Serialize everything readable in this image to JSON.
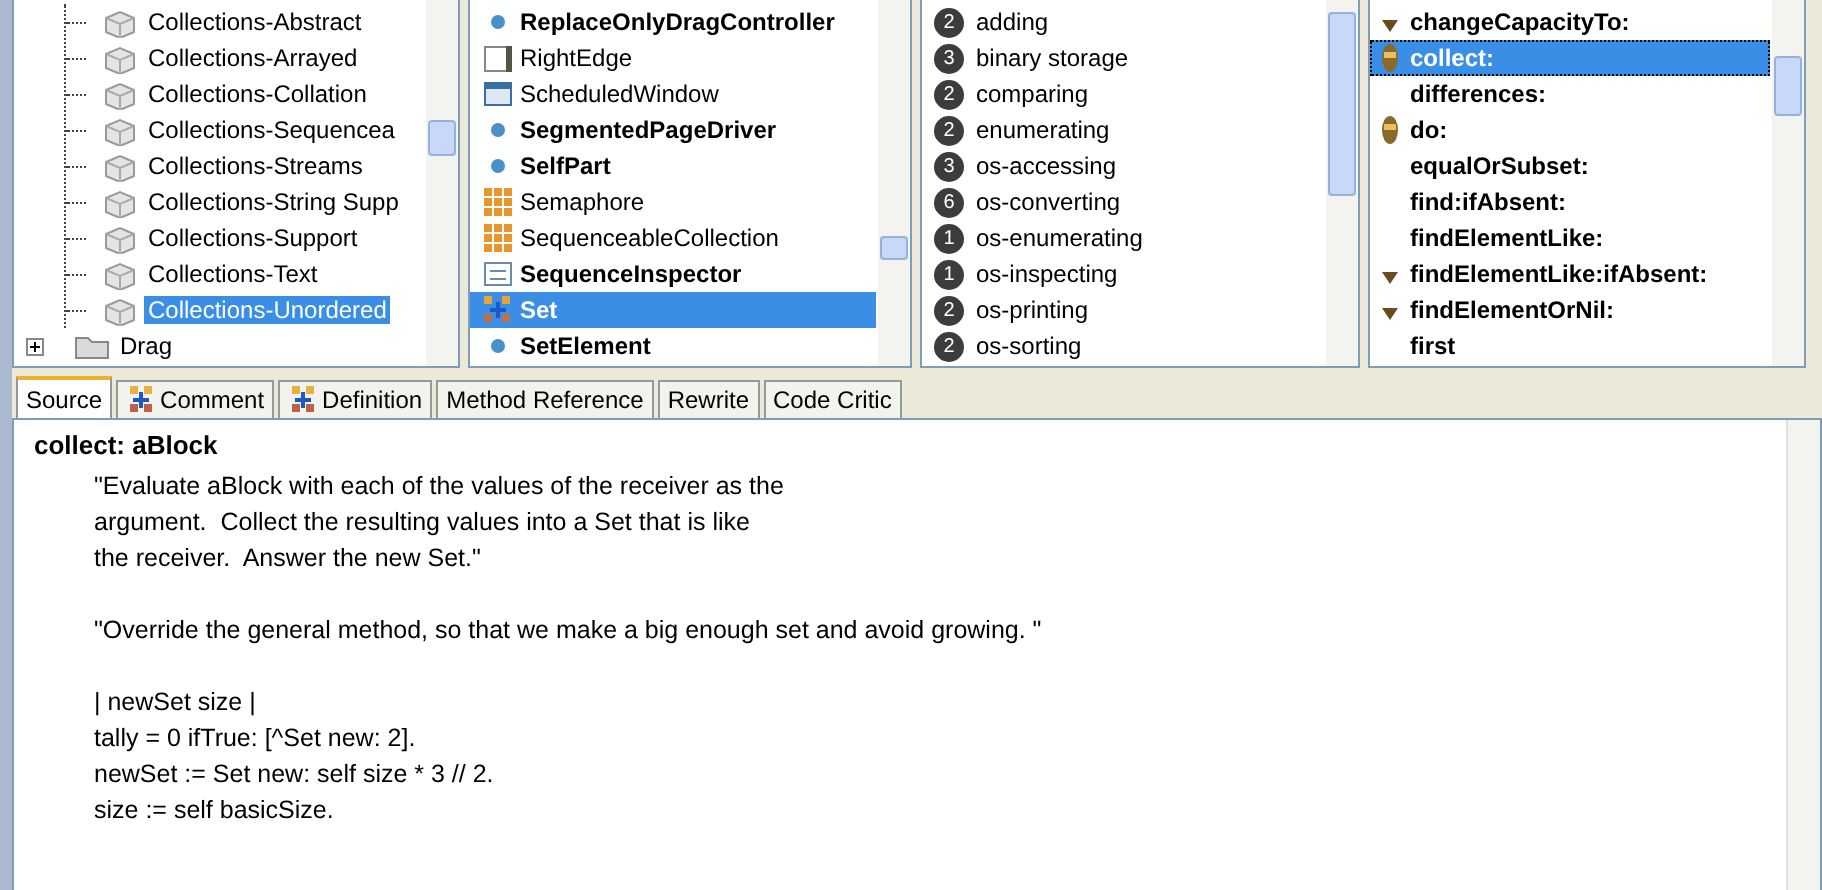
{
  "packages": {
    "items": [
      {
        "expanded": true,
        "children": [
          {
            "label": "Collections-Abstract",
            "selected": false
          },
          {
            "label": "Collections-Arrayed",
            "selected": false
          },
          {
            "label": "Collections-Collation",
            "selected": false
          },
          {
            "label": "Collections-Sequencea",
            "selected": false
          },
          {
            "label": "Collections-Streams",
            "selected": false
          },
          {
            "label": "Collections-String Supp",
            "selected": false
          },
          {
            "label": "Collections-Support",
            "selected": false
          },
          {
            "label": "Collections-Text",
            "selected": false
          },
          {
            "label": "Collections-Unordered",
            "selected": true
          }
        ]
      },
      {
        "label": "Drag",
        "expanded": false,
        "selected": false
      }
    ]
  },
  "classes": [
    {
      "label": "ReplaceOnlyDragController",
      "kind": "dot",
      "bold": true,
      "selected": false
    },
    {
      "label": "RightEdge",
      "kind": "edge",
      "bold": false,
      "selected": false
    },
    {
      "label": "ScheduledWindow",
      "kind": "window",
      "bold": false,
      "selected": false
    },
    {
      "label": "SegmentedPageDriver",
      "kind": "dot",
      "bold": true,
      "selected": false
    },
    {
      "label": "SelfPart",
      "kind": "dot",
      "bold": true,
      "selected": false
    },
    {
      "label": "Semaphore",
      "kind": "grid",
      "bold": false,
      "selected": false
    },
    {
      "label": "SequenceableCollection",
      "kind": "grid",
      "bold": false,
      "selected": false
    },
    {
      "label": "SequenceInspector",
      "kind": "inspector",
      "bold": true,
      "selected": false
    },
    {
      "label": "Set",
      "kind": "set",
      "bold": true,
      "selected": true
    },
    {
      "label": "SetElement",
      "kind": "dot",
      "bold": true,
      "selected": false
    }
  ],
  "categories": [
    {
      "count": "2",
      "label": "adding",
      "selected": false
    },
    {
      "count": "3",
      "label": "binary storage",
      "selected": false
    },
    {
      "count": "2",
      "label": "comparing",
      "selected": false
    },
    {
      "count": "2",
      "label": "enumerating",
      "selected": false
    },
    {
      "count": "3",
      "label": "os-accessing",
      "selected": false
    },
    {
      "count": "6",
      "label": "os-converting",
      "selected": false
    },
    {
      "count": "1",
      "label": "os-enumerating",
      "selected": false
    },
    {
      "count": "1",
      "label": "os-inspecting",
      "selected": false
    },
    {
      "count": "2",
      "label": "os-printing",
      "selected": false
    },
    {
      "count": "2",
      "label": "os-sorting",
      "selected": false
    }
  ],
  "methods": [
    {
      "label": "changeCapacityTo:",
      "kind": "small",
      "selected": false
    },
    {
      "label": "collect:",
      "kind": "tall",
      "selected": true
    },
    {
      "label": "differences:",
      "kind": "none",
      "selected": false
    },
    {
      "label": "do:",
      "kind": "tall",
      "selected": false
    },
    {
      "label": "equalOrSubset:",
      "kind": "none",
      "selected": false
    },
    {
      "label": "find:ifAbsent:",
      "kind": "none",
      "selected": false
    },
    {
      "label": "findElementLike:",
      "kind": "none",
      "selected": false
    },
    {
      "label": "findElementLike:ifAbsent:",
      "kind": "small",
      "selected": false
    },
    {
      "label": "findElementOrNil:",
      "kind": "small",
      "selected": false
    },
    {
      "label": "first",
      "kind": "none",
      "selected": false
    }
  ],
  "tabs": [
    {
      "label": "Source",
      "icon": false,
      "selected": true
    },
    {
      "label": "Comment",
      "icon": true,
      "selected": false
    },
    {
      "label": "Definition",
      "icon": true,
      "selected": false
    },
    {
      "label": "Method Reference",
      "icon": false,
      "selected": false
    },
    {
      "label": "Rewrite",
      "icon": false,
      "selected": false
    },
    {
      "label": "Code Critic",
      "icon": false,
      "selected": false
    }
  ],
  "source": {
    "title": "collect: aBlock",
    "paragraphs": [
      [
        "\"Evaluate aBlock with each of the values of the receiver as the",
        "argument.  Collect the resulting values into a Set that is like",
        "the receiver.  Answer the new Set.\""
      ],
      [
        "\"Override the general method, so that we make a big enough set and avoid growing. \""
      ],
      [
        "| newSet size |",
        "tally = 0 ifTrue: [^Set new: 2].",
        "newSet := Set new: self size * 3 // 2.",
        "size := self basicSize."
      ]
    ]
  }
}
